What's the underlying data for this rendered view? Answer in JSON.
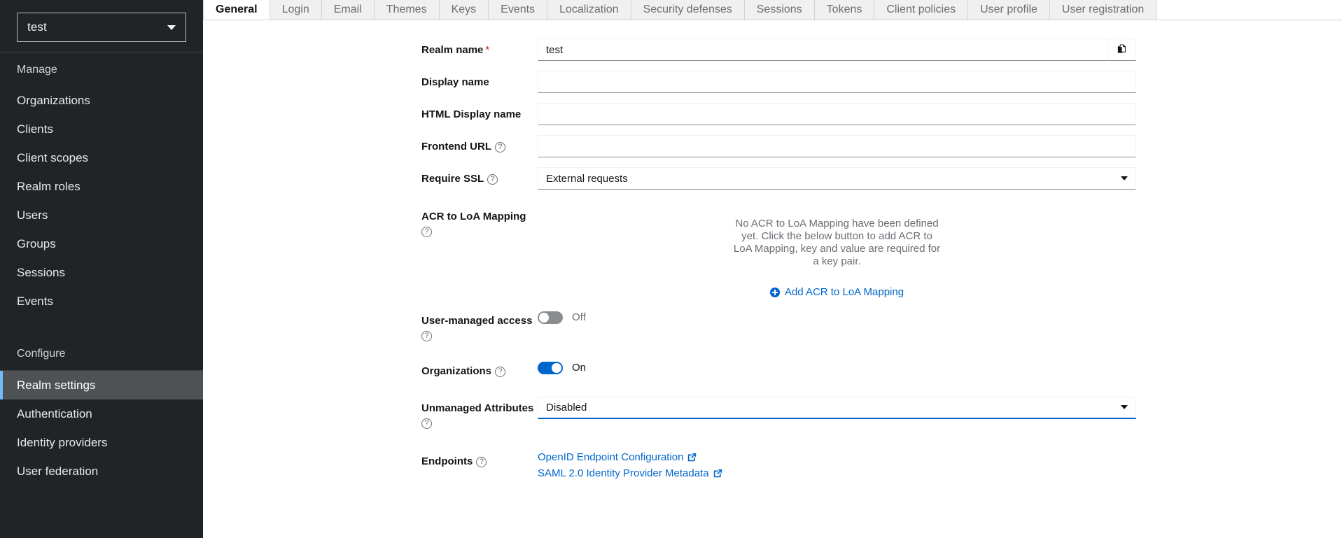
{
  "sidebar": {
    "realm_selector": {
      "value": "test",
      "icon": "chevron-down-icon"
    },
    "sections": [
      {
        "title": "Manage",
        "items": [
          {
            "label": "Organizations",
            "active": false
          },
          {
            "label": "Clients",
            "active": false
          },
          {
            "label": "Client scopes",
            "active": false
          },
          {
            "label": "Realm roles",
            "active": false
          },
          {
            "label": "Users",
            "active": false
          },
          {
            "label": "Groups",
            "active": false
          },
          {
            "label": "Sessions",
            "active": false
          },
          {
            "label": "Events",
            "active": false
          }
        ]
      },
      {
        "title": "Configure",
        "items": [
          {
            "label": "Realm settings",
            "active": true
          },
          {
            "label": "Authentication",
            "active": false
          },
          {
            "label": "Identity providers",
            "active": false
          },
          {
            "label": "User federation",
            "active": false
          }
        ]
      }
    ]
  },
  "tabs": [
    {
      "label": "General",
      "active": true
    },
    {
      "label": "Login",
      "active": false
    },
    {
      "label": "Email",
      "active": false
    },
    {
      "label": "Themes",
      "active": false
    },
    {
      "label": "Keys",
      "active": false
    },
    {
      "label": "Events",
      "active": false
    },
    {
      "label": "Localization",
      "active": false
    },
    {
      "label": "Security defenses",
      "active": false
    },
    {
      "label": "Sessions",
      "active": false
    },
    {
      "label": "Tokens",
      "active": false
    },
    {
      "label": "Client policies",
      "active": false
    },
    {
      "label": "User profile",
      "active": false
    },
    {
      "label": "User registration",
      "active": false
    }
  ],
  "form": {
    "realm_name": {
      "label": "Realm name",
      "required_marker": "*",
      "value": "test",
      "placeholder": "",
      "copy_icon": "copy-icon"
    },
    "display_name": {
      "label": "Display name",
      "value": "",
      "placeholder": ""
    },
    "html_display_name": {
      "label": "HTML Display name",
      "value": "",
      "placeholder": ""
    },
    "frontend_url": {
      "label": "Frontend URL",
      "value": "",
      "placeholder": "",
      "help_icon": "help-circle-icon"
    },
    "require_ssl": {
      "label": "Require SSL",
      "value": "External requests",
      "help_icon": "help-circle-icon",
      "caret_icon": "caret-down-icon"
    },
    "acr_to_loa": {
      "label": "ACR to LoA Mapping",
      "help_icon": "help-circle-icon",
      "empty_text": "No ACR to LoA Mapping have been defined yet. Click the below button to add ACR to LoA Mapping, key and value are required for a key pair.",
      "add_button_label": "Add ACR to LoA Mapping",
      "add_button_icon": "plus-circle-icon"
    },
    "user_managed_access": {
      "label": "User-managed access",
      "state_label": "Off",
      "on": false,
      "help_icon": "help-circle-icon"
    },
    "organizations": {
      "label": "Organizations",
      "state_label": "On",
      "on": true,
      "help_icon": "help-circle-icon"
    },
    "unmanaged_attributes": {
      "label": "Unmanaged Attributes",
      "value": "Disabled",
      "help_icon": "help-circle-icon",
      "caret_icon": "caret-down-icon",
      "focused": true
    },
    "endpoints": {
      "label": "Endpoints",
      "help_icon": "help-circle-icon",
      "links": [
        {
          "label": "OpenID Endpoint Configuration",
          "icon": "external-link-icon"
        },
        {
          "label": "SAML 2.0 Identity Provider Metadata",
          "icon": "external-link-icon"
        }
      ]
    }
  },
  "colors": {
    "sidebar_bg": "#212427",
    "accent_blue": "#0066cc",
    "active_nav_border": "#73bcf7",
    "required_red": "#c9190b",
    "muted_text": "#6a6e73"
  }
}
